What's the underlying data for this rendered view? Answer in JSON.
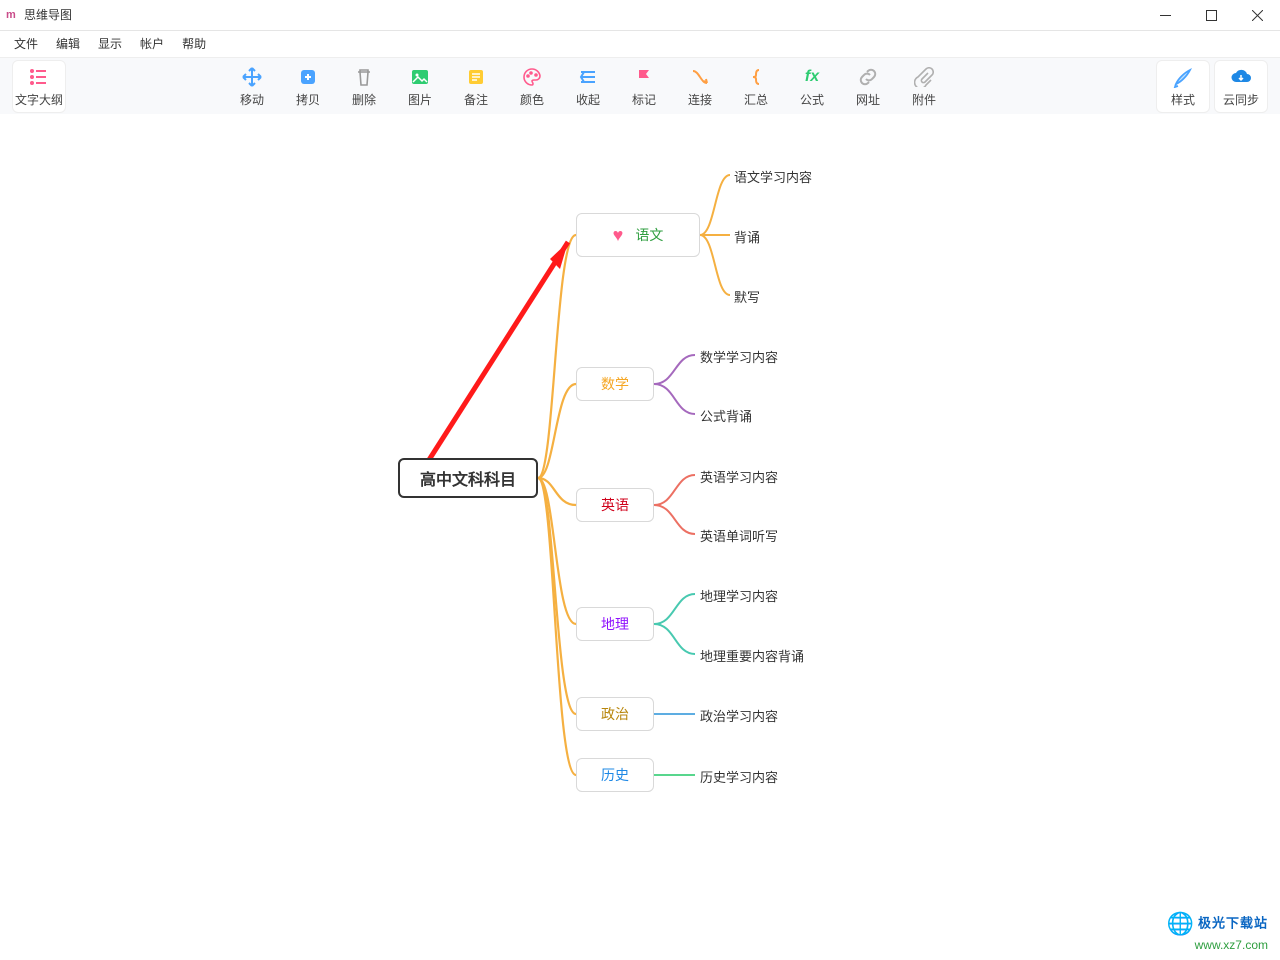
{
  "app": {
    "brand": "m",
    "title": "思维导图"
  },
  "menubar": {
    "file": "文件",
    "edit": "编辑",
    "display": "显示",
    "account": "帐户",
    "help": "帮助"
  },
  "toolbar": {
    "outline": "文字大纲",
    "move": "移动",
    "copy": "拷贝",
    "delete": "删除",
    "image": "图片",
    "note": "备注",
    "color": "颜色",
    "collapse": "收起",
    "mark": "标记",
    "connect": "连接",
    "summary": "汇总",
    "formula": "公式",
    "url": "网址",
    "attach": "附件",
    "style": "样式",
    "cloud": "云同步"
  },
  "mindmap": {
    "root": "高中文科科目",
    "subjects": [
      {
        "label": "语文",
        "color": "#2e9e3f",
        "marker": "heart",
        "children": [
          "语文学习内容",
          "背诵",
          "默写"
        ]
      },
      {
        "label": "数学",
        "color": "#f5a623",
        "children": [
          "数学学习内容",
          "公式背诵"
        ]
      },
      {
        "label": "英语",
        "color": "#d0021b",
        "children": [
          "英语学习内容",
          "英语单词听写"
        ]
      },
      {
        "label": "地理",
        "color": "#9013fe",
        "children": [
          "地理学习内容",
          "地理重要内容背诵"
        ]
      },
      {
        "label": "政治",
        "color": "#b8860b",
        "children": [
          "政治学习内容"
        ]
      },
      {
        "label": "历史",
        "color": "#1e88e5",
        "children": [
          "历史学习内容"
        ]
      }
    ]
  },
  "watermark": {
    "line1": "极光下载站",
    "line2": "www.xz7.com"
  }
}
